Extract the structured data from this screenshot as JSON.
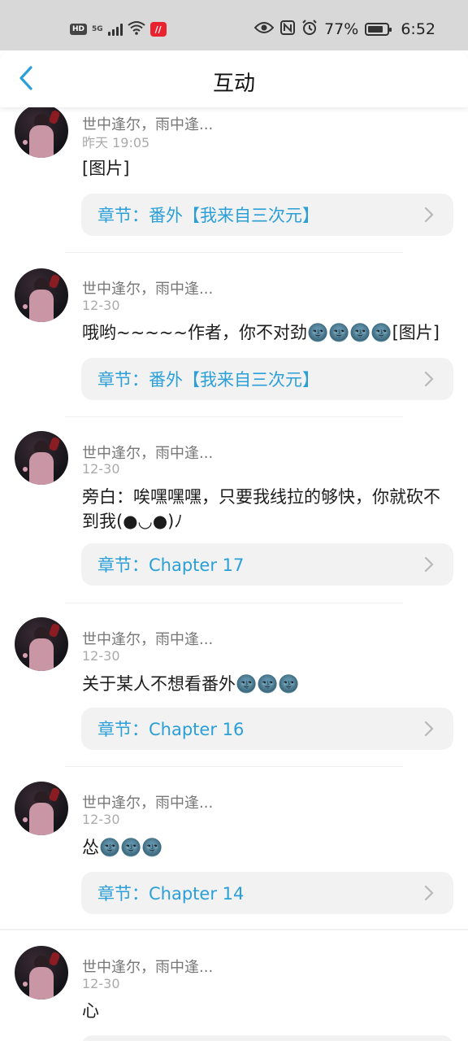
{
  "status_bar": {
    "hd": "HD",
    "network": "5G",
    "battery_level": 77,
    "battery_text": "77%",
    "time": "6:52"
  },
  "header": {
    "title": "互动",
    "back_icon": "chevron-left-icon",
    "accent_color": "#2a9fd8"
  },
  "items": [
    {
      "name": "世中逢尔，雨中逢...",
      "time": "昨天 19:05",
      "content": "[图片]",
      "chapter_label": "章节：番外【我来自三次元】"
    },
    {
      "name": "世中逢尔，雨中逢...",
      "time": "12-30",
      "content": "哦哟~~~~~作者，你不对劲🌚🌚🌚🌚[图片]",
      "chapter_label": "章节：番外【我来自三次元】"
    },
    {
      "name": "世中逢尔，雨中逢...",
      "time": "12-30",
      "content": "旁白：唉嘿嘿嘿，只要我线拉的够快，你就砍不到我(●◡●)ﾉ",
      "chapter_label": "章节：Chapter 17"
    },
    {
      "name": "世中逢尔，雨中逢...",
      "time": "12-30",
      "content": "关于某人不想看番外🌚🌚🌚",
      "chapter_label": "章节：Chapter 16"
    },
    {
      "name": "世中逢尔，雨中逢...",
      "time": "12-30",
      "content": "怂🌚🌚🌚",
      "chapter_label": "章节：Chapter 14"
    },
    {
      "name": "世中逢尔，雨中逢...",
      "time": "12-30",
      "content": "心",
      "chapter_label": ""
    }
  ]
}
